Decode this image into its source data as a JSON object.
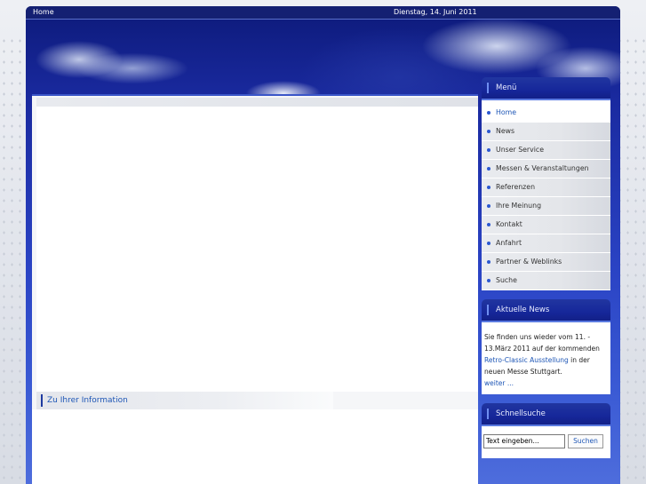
{
  "topbar": {
    "home_label": "Home",
    "date": "Dienstag, 14. Juni 2011"
  },
  "info": {
    "heading": "Zu Ihrer Information"
  },
  "menu": {
    "title": "Menü",
    "items": [
      {
        "label": "Home",
        "active": true
      },
      {
        "label": "News"
      },
      {
        "label": "Unser Service"
      },
      {
        "label": "Messen & Veranstaltungen"
      },
      {
        "label": "Referenzen"
      },
      {
        "label": "Ihre Meinung"
      },
      {
        "label": "Kontakt"
      },
      {
        "label": "Anfahrt"
      },
      {
        "label": "Partner & Weblinks"
      },
      {
        "label": "Suche"
      }
    ]
  },
  "news": {
    "title": "Aktuelle News",
    "text_before": "Sie finden uns wieder vom 11. - 13.März 2011 auf der kommenden ",
    "link_text": "Retro-Classic Ausstellung",
    "text_after": " in der neuen Messe Stuttgart.",
    "more_link": "weiter ..."
  },
  "search": {
    "title": "Schnellsuche",
    "input_value": "Text eingeben...",
    "button_label": "Suchen"
  }
}
